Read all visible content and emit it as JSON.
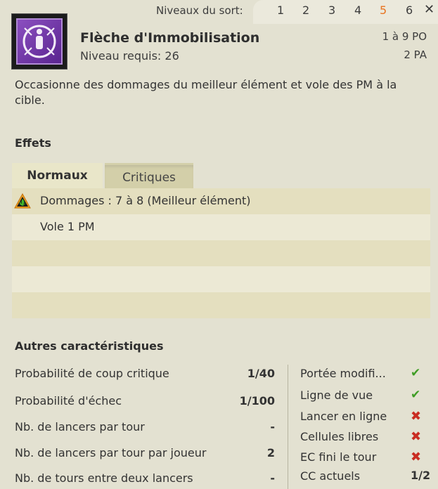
{
  "levels": {
    "label": "Niveaux du sort:",
    "items": [
      "1",
      "2",
      "3",
      "4",
      "5",
      "6"
    ],
    "active_index": 4,
    "close_glyph": "✕"
  },
  "spell": {
    "icon": "immobilization-spell-icon",
    "name": "Flèche d'Immobilisation",
    "required_level": "Niveau requis: 26",
    "range": "1 à 9 PO",
    "cost": "2 PA",
    "description": "Occasionne des dommages du meilleur élément et vole des PM à la cible."
  },
  "effects": {
    "title": "Effets",
    "tabs": [
      "Normaux",
      "Critiques"
    ],
    "active_tab": 0,
    "rows": [
      {
        "text": "Dommages : 7 à 8 (Meilleur élément)",
        "icon": "best-element-icon"
      },
      {
        "text": "Vole 1 PM",
        "icon": ""
      },
      {
        "text": "",
        "icon": ""
      },
      {
        "text": "",
        "icon": ""
      },
      {
        "text": "",
        "icon": ""
      }
    ]
  },
  "characteristics": {
    "title": "Autres caractéristiques",
    "rows": [
      {
        "label": "Probabilité de coup critique",
        "value": "1/40"
      },
      {
        "label": "Probabilité d'échec",
        "value": "1/100"
      },
      {
        "label": "Nb. de lancers par tour",
        "value": "-"
      },
      {
        "label": "Nb. de lancers par tour par joueur",
        "value": "2"
      },
      {
        "label": "Nb. de tours entre deux lancers",
        "value": "-"
      }
    ],
    "properties": [
      {
        "label": "Portée modifi...",
        "mark": "check"
      },
      {
        "label": "Ligne de vue",
        "mark": "check"
      },
      {
        "label": "Lancer en ligne",
        "mark": "cross"
      },
      {
        "label": "Cellules libres",
        "mark": "cross"
      },
      {
        "label": "EC fini le tour",
        "mark": "cross"
      },
      {
        "label": "CC actuels",
        "mark": "1/2"
      }
    ]
  },
  "colors": {
    "active_level": "#e8731f",
    "check": "#3f9d25",
    "cross": "#c92d22"
  }
}
